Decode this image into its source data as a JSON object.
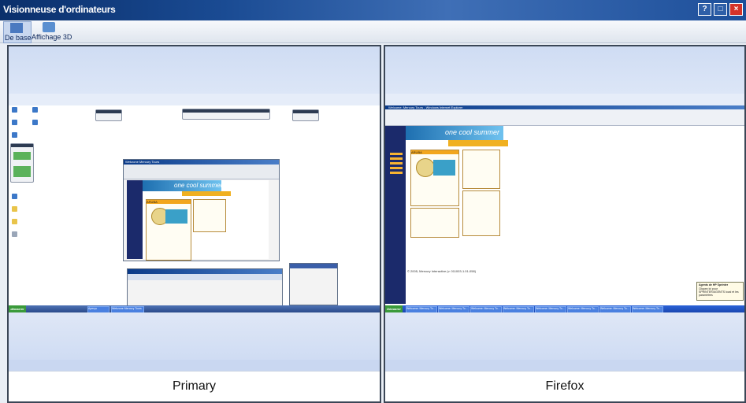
{
  "window": {
    "title": "Visionneuse d'ordinateurs",
    "buttons": [
      "?",
      "□",
      "×"
    ]
  },
  "toolbar": {
    "basic_label": "De base",
    "view3d_label": "Affichage 3D",
    "basic_icon": "grid-icon",
    "view3d_icon": "monitor-3d-icon"
  },
  "screens": [
    {
      "name": "Primary",
      "active_window_title": "Webzone Mercury Tours",
      "banner_text": "one cool summer",
      "badge": "ARUBA",
      "taskbar": {
        "start": "démarrer",
        "items": [
          "Aperçu",
          "Webzone Mercury Tours"
        ]
      }
    },
    {
      "name": "Firefox",
      "active_window_title": "Welcome: Mercury Tours - Windows Internet Explorer",
      "banner_text": "one cool summer",
      "badge": "ARUBA",
      "copyright": "© 2005, Mercury Interactive (v. 011003-1.01-058)",
      "popup": {
        "title": "Agents de HP Sprinter",
        "body": "Cliquez ici pour SPRINTER/AGENTS local et les paramètres"
      },
      "taskbar": {
        "start": "Démarrer",
        "items": [
          "Welcome: Mercury To...",
          "Welcome: Mercury To...",
          "Welcome: Mercury To...",
          "Welcome: Mercury To...",
          "Welcome: Mercury To...",
          "Welcome: Mercury To...",
          "Welcome: Mercury To...",
          "Welcome: Mercury To..."
        ]
      }
    }
  ]
}
